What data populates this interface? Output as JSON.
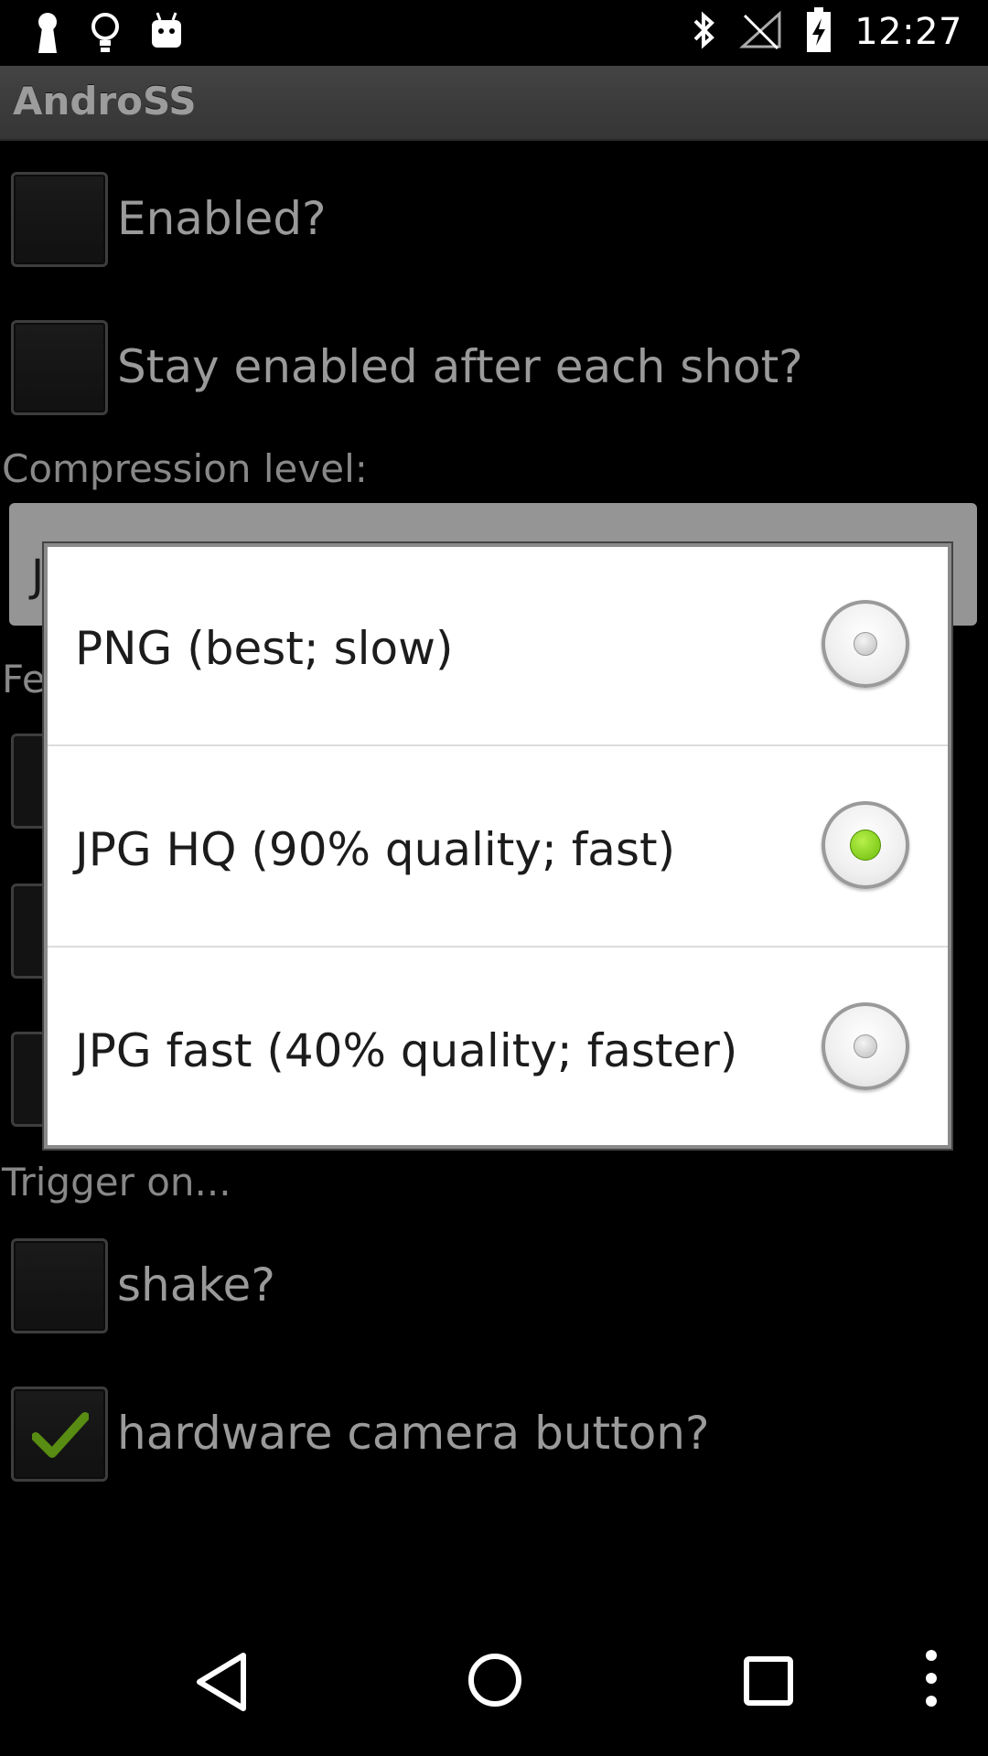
{
  "status_bar": {
    "time": "12:27",
    "left_icons": [
      "keyhole-icon",
      "lightbulb-icon",
      "android-icon"
    ],
    "right_icons": [
      "bluetooth-icon",
      "wifi-off-icon",
      "battery-charging-icon"
    ]
  },
  "app": {
    "title": "AndroSS"
  },
  "settings": {
    "enabled_label": "Enabled?",
    "stay_enabled_label": "Stay enabled after each shot?",
    "compression_header": "Compression level:",
    "trigger_header": "Trigger on...",
    "shake_label": "shake?",
    "camera_button_label": "hardware camera button?",
    "partial_header_fragment": "Fe",
    "spinner_fragment": "J"
  },
  "dialog": {
    "options": [
      {
        "label": "PNG (best; slow)",
        "selected": false
      },
      {
        "label": "JPG HQ (90% quality; fast)",
        "selected": true
      },
      {
        "label": "JPG fast (40% quality; faster)",
        "selected": false
      }
    ]
  },
  "nav_bar": {
    "buttons": [
      "back-icon",
      "home-icon",
      "recents-icon",
      "overflow-menu-icon"
    ]
  },
  "colors": {
    "accent_green": "#6cbd0a",
    "background": "#000000",
    "dialog_bg": "#ffffff"
  }
}
